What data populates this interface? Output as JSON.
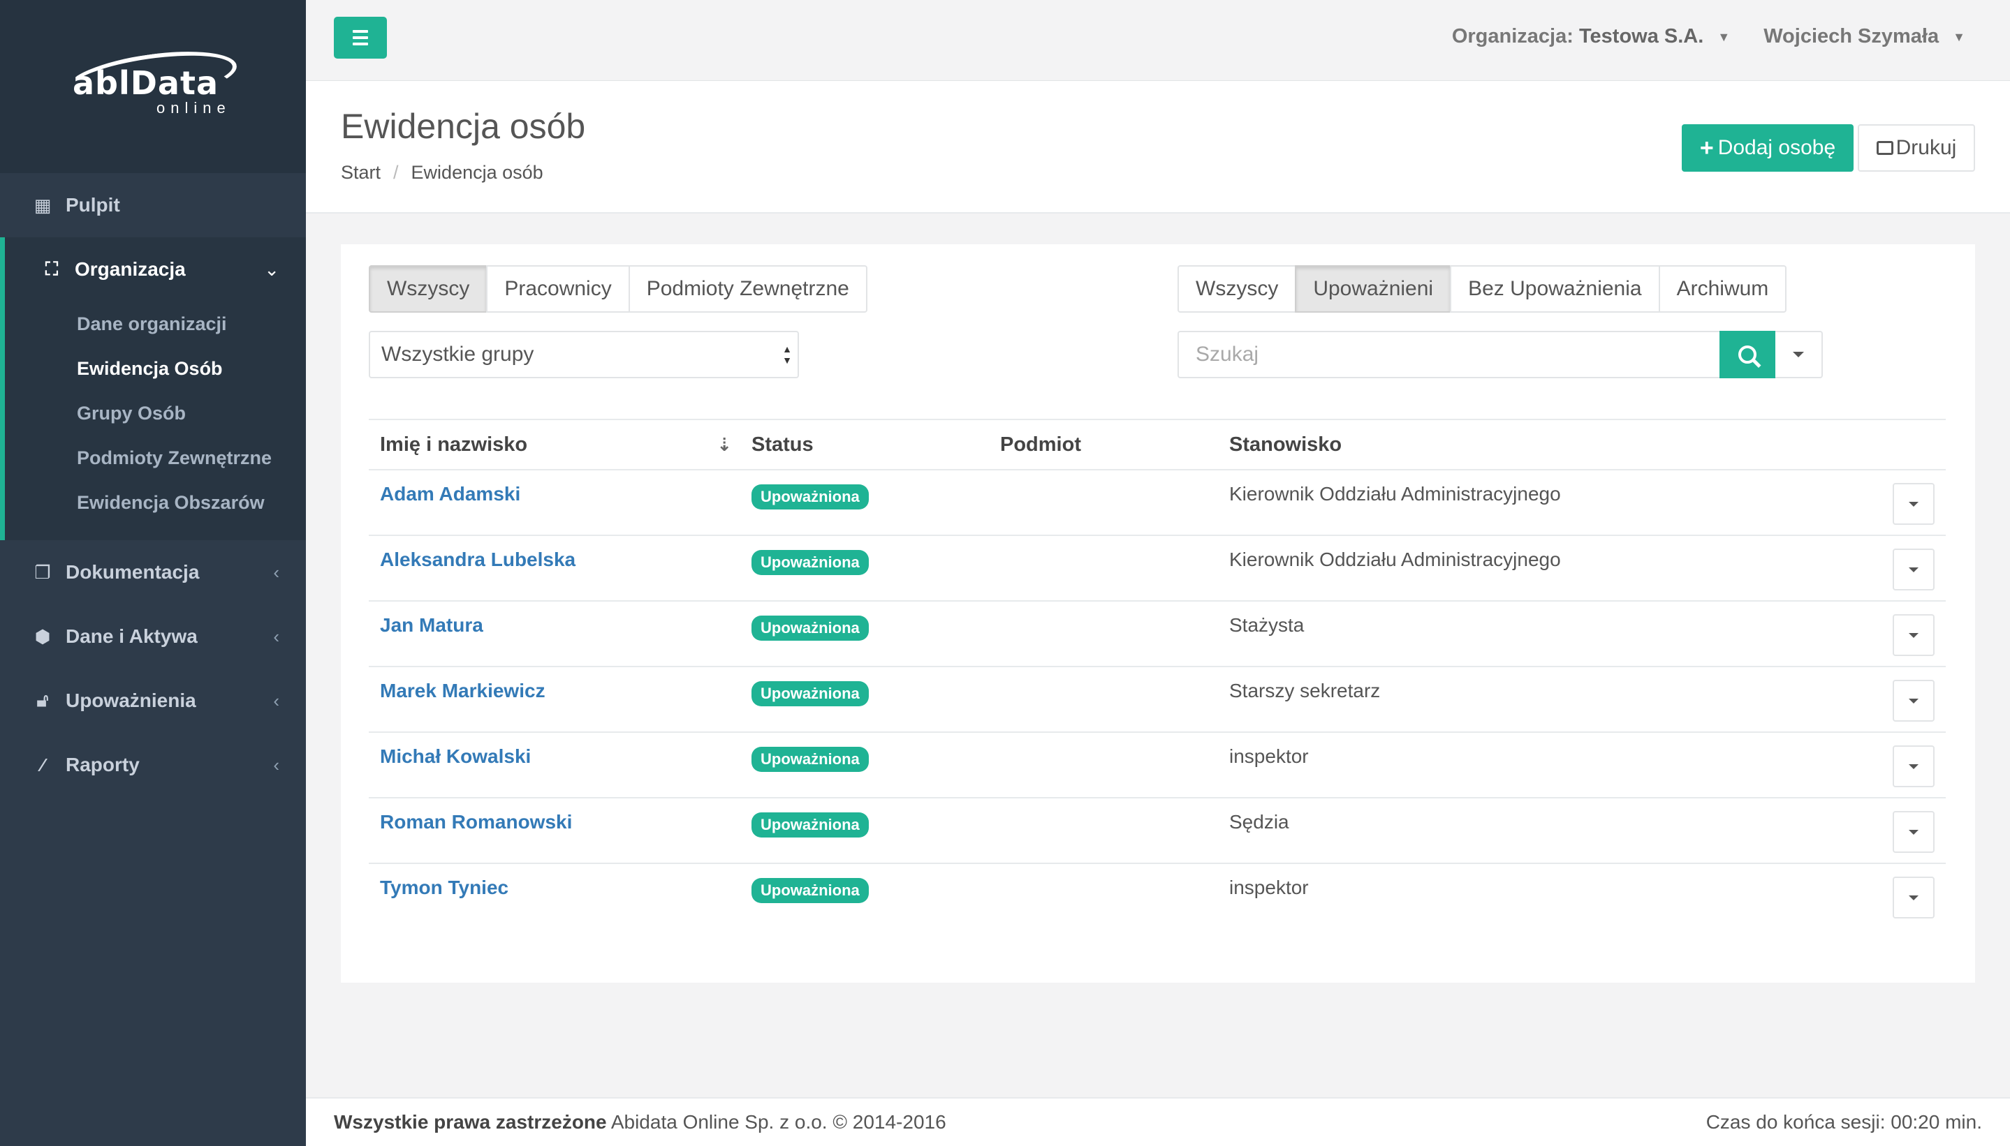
{
  "brand": {
    "logo_text": "ablData",
    "logo_sub": "online"
  },
  "sidebar": {
    "items": [
      {
        "label": "Pulpit",
        "icon": "dashboard-icon"
      },
      {
        "label": "Organizacja",
        "icon": "sitemap-icon",
        "expanded": true,
        "children": [
          {
            "label": "Dane organizacji"
          },
          {
            "label": "Ewidencja Osób",
            "active": true
          },
          {
            "label": "Grupy Osób"
          },
          {
            "label": "Podmioty Zewnętrzne"
          },
          {
            "label": "Ewidencja Obszarów"
          }
        ]
      },
      {
        "label": "Dokumentacja",
        "icon": "documents-icon"
      },
      {
        "label": "Dane i Aktywa",
        "icon": "cubes-icon"
      },
      {
        "label": "Upoważnienia",
        "icon": "unlock-icon"
      },
      {
        "label": "Raporty",
        "icon": "magic-wand-icon"
      }
    ]
  },
  "topbar": {
    "org_prefix": "Organizacja:",
    "org_name": "Testowa S.A.",
    "user_name": "Wojciech Szymała"
  },
  "heading": {
    "title": "Ewidencja osób",
    "breadcrumb": [
      "Start",
      "Ewidencja osób"
    ],
    "add_button": "Dodaj osobę",
    "print_button": "Drukuj"
  },
  "filters": {
    "type_tabs": [
      "Wszyscy",
      "Pracownicy",
      "Podmioty Zewnętrzne"
    ],
    "type_active": "Wszyscy",
    "auth_tabs": [
      "Wszyscy",
      "Upoważnieni",
      "Bez Upoważnienia",
      "Archiwum"
    ],
    "auth_active": "Upoważnieni",
    "group_select": "Wszystkie grupy",
    "search_placeholder": "Szukaj"
  },
  "table": {
    "columns": [
      "Imię i nazwisko",
      "Status",
      "Podmiot",
      "Stanowisko"
    ],
    "rows": [
      {
        "name": "Adam Adamski",
        "status": "Upoważniona",
        "podmiot": "",
        "position": "Kierownik Oddziału Administracyjnego"
      },
      {
        "name": "Aleksandra Lubelska",
        "status": "Upoważniona",
        "podmiot": "",
        "position": "Kierownik Oddziału Administracyjnego"
      },
      {
        "name": "Jan Matura",
        "status": "Upoważniona",
        "podmiot": "",
        "position": "Stażysta"
      },
      {
        "name": "Marek Markiewicz",
        "status": "Upoważniona",
        "podmiot": "",
        "position": "Starszy sekretarz"
      },
      {
        "name": "Michał Kowalski",
        "status": "Upoważniona",
        "podmiot": "",
        "position": "inspektor"
      },
      {
        "name": "Roman Romanowski",
        "status": "Upoważniona",
        "podmiot": "",
        "position": "Sędzia"
      },
      {
        "name": "Tymon Tyniec",
        "status": "Upoważniona",
        "podmiot": "",
        "position": "inspektor"
      }
    ]
  },
  "footer": {
    "rights_bold": "Wszystkie prawa zastrzeżone",
    "rights_rest": "Abidata Online Sp. z o.o. © 2014-2016",
    "session": "Czas do końca sesji: 00:20 min."
  },
  "colors": {
    "accent": "#1fb394",
    "sidebar": "#2e3b4a",
    "link": "#337ab7"
  }
}
